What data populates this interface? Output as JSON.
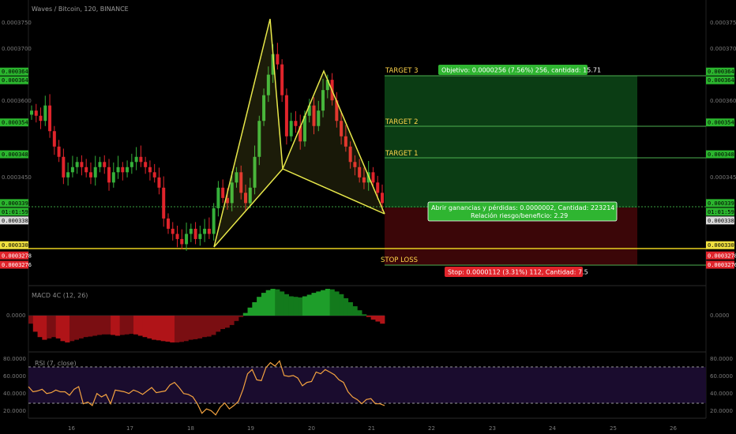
{
  "title": "Waves / Bitcoin, 120, BINANCE",
  "colors": {
    "background": "#000000",
    "candle_up": "#35b03a",
    "candle_down": "#e0242b",
    "pattern": "#e8e84a",
    "target_line": "#4caf50",
    "profit_zone": "#0b3d14",
    "loss_zone": "#3b0608",
    "stop_line": "#e8d020",
    "macd_up": "#1e9e2a",
    "macd_down": "#b01418",
    "rsi_line": "#f4a340",
    "rsi_band": "#1a0c2e"
  },
  "price_axis": {
    "ticks": [
      "0.0003750",
      "0.0003700",
      "0.0003600",
      "0.0003450"
    ],
    "tags_left": [
      {
        "text": "0.0003646",
        "bg": "#2bb52e",
        "fg": "#000000",
        "value": 0.0003646
      },
      {
        "text": "0.0003644",
        "bg": "#2bb52e",
        "fg": "#000000",
        "value": 0.0003644
      },
      {
        "text": "0.0003547",
        "bg": "#2bb52e",
        "fg": "#000000",
        "value": 0.0003547
      },
      {
        "text": "0.0003485",
        "bg": "#2bb52e",
        "fg": "#000000",
        "value": 0.0003485
      },
      {
        "text": "0.0003390",
        "bg": "#2bb52e",
        "fg": "#000000",
        "value": 0.000339
      },
      {
        "text": "01:01:59",
        "bg": "#2bb52e",
        "fg": "#000000",
        "value": 0.0003377
      },
      {
        "text": "0.0003388",
        "bg": "#d9d9d9",
        "fg": "#000000",
        "value": 0.0003363
      },
      {
        "text": "0.0003308",
        "bg": "#f0e040",
        "fg": "#000000",
        "value": 0.0003308
      },
      {
        "text": "0.0003278",
        "bg": "#e0242b",
        "fg": "#ffffff",
        "value": 0.0003288
      },
      {
        "text": "0.0003276",
        "bg": "#e0242b",
        "fg": "#ffffff",
        "value": 0.000327
      }
    ]
  },
  "time_axis": [
    "16",
    "17",
    "18",
    "19",
    "20",
    "21",
    "22",
    "23",
    "24",
    "25",
    "26"
  ],
  "trade": {
    "targets": [
      {
        "label": "TARGET 3",
        "value": 0.0003646
      },
      {
        "label": "TARGET 2",
        "value": 0.0003547
      },
      {
        "label": "TARGET 1",
        "value": 0.0003485
      }
    ],
    "entry": 0.000339,
    "stop_label": "STOP LOSS",
    "stop_value": 0.0003278,
    "support": 0.0003308,
    "objective_text": "Objetivo: 0.0000256 (7.56%) 256, cantidad: 15.71",
    "pnl_line1": "Abrir ganancias y pérdidas: 0.0000002, Cantidad: 223214",
    "pnl_line2": "Relación riesgo/beneficio: 2.29",
    "stop_text": "Stop: 0.0000112 (3.31%) 112, Cantidad: 7.5"
  },
  "macd": {
    "label": "MACD 4C (12, 26)",
    "zero_label": "0.0000"
  },
  "rsi": {
    "label": "RSI (7, close)",
    "ticks": [
      "80.0000",
      "60.0000",
      "40.0000",
      "20.0000"
    ],
    "upper": 70,
    "lower": 30
  },
  "chart_data": [
    {
      "type": "candlestick",
      "title": "Waves / Bitcoin, 120, BINANCE",
      "x_categories": [
        "16",
        "17",
        "18",
        "19",
        "20",
        "21"
      ],
      "close": [
        0.000357,
        0.000356,
        0.000355,
        0.000358,
        0.000353,
        0.00035,
        0.000348,
        0.000344,
        0.000345,
        0.000346,
        0.000347,
        0.000346,
        0.000345,
        0.000344,
        0.000346,
        0.000347,
        0.000346,
        0.000343,
        0.000345,
        0.000346,
        0.000345,
        0.000346,
        0.000347,
        0.000348,
        0.000347,
        0.000346,
        0.000345,
        0.000344,
        0.000342,
        0.000336,
        0.000334,
        0.000333,
        0.000332,
        0.000331,
        0.000333,
        0.000334,
        0.000332,
        0.000333,
        0.000334,
        0.000333,
        0.000338,
        0.000342,
        0.00034,
        0.000339,
        0.000343,
        0.000345,
        0.000341,
        0.000339,
        0.000342,
        0.000348,
        0.000355,
        0.00036,
        0.000364,
        0.000368,
        0.000366,
        0.00036,
        0.000352,
        0.000355,
        0.000354,
        0.000351,
        0.000356,
        0.000358,
        0.000354,
        0.000357,
        0.000361,
        0.000363,
        0.000359,
        0.000355,
        0.000352,
        0.00035,
        0.000347,
        0.000346,
        0.000344,
        0.000343,
        0.000345,
        0.000343,
        0.000341,
        0.000339
      ],
      "y_range": [
        0.000324,
        0.000377
      ],
      "pattern": "harmonic (yellow)",
      "targets": [
        0.0003646,
        0.0003547,
        0.0003485
      ],
      "entry": 0.000339,
      "stop": 0.0003278
    },
    {
      "type": "area",
      "title": "MACD 4C (12, 26)",
      "x": [
        0,
        1,
        2,
        3,
        4,
        5,
        6,
        7,
        8,
        9,
        10,
        11,
        12,
        13,
        14,
        15,
        16,
        17,
        18,
        19,
        20,
        21,
        22,
        23,
        24,
        25,
        26,
        27,
        28,
        29,
        30,
        31,
        32,
        33,
        34,
        35,
        36,
        37,
        38,
        39,
        40,
        41,
        42,
        43,
        44,
        45,
        46,
        47,
        48,
        49,
        50,
        51,
        52,
        53,
        54,
        55,
        56,
        57,
        58,
        59,
        60,
        61,
        62,
        63,
        64,
        65,
        66,
        67,
        68,
        69,
        70,
        71,
        72,
        73,
        74,
        75,
        76,
        77
      ],
      "values": [
        -0.3,
        -0.6,
        -0.8,
        -0.9,
        -0.85,
        -0.8,
        -0.85,
        -0.95,
        -1.0,
        -0.95,
        -0.9,
        -0.85,
        -0.8,
        -0.78,
        -0.75,
        -0.72,
        -0.7,
        -0.7,
        -0.72,
        -0.75,
        -0.72,
        -0.7,
        -0.68,
        -0.7,
        -0.75,
        -0.8,
        -0.85,
        -0.9,
        -0.92,
        -0.95,
        -0.97,
        -1.0,
        -1.0,
        -0.98,
        -0.95,
        -0.9,
        -0.88,
        -0.85,
        -0.8,
        -0.78,
        -0.72,
        -0.6,
        -0.5,
        -0.45,
        -0.35,
        -0.2,
        -0.05,
        0.1,
        0.3,
        0.5,
        0.7,
        0.85,
        0.95,
        1.0,
        0.98,
        0.9,
        0.8,
        0.72,
        0.7,
        0.68,
        0.72,
        0.78,
        0.85,
        0.9,
        0.95,
        1.0,
        0.98,
        0.9,
        0.8,
        0.65,
        0.5,
        0.35,
        0.2,
        0.05,
        -0.05,
        -0.15,
        -0.22,
        -0.3
      ]
    },
    {
      "type": "line",
      "title": "RSI (7, close)",
      "ylim": [
        15,
        85
      ],
      "values": [
        50,
        44,
        45,
        47,
        42,
        43,
        46,
        44,
        44,
        40,
        47,
        50,
        30,
        32,
        28,
        42,
        38,
        41,
        30,
        46,
        45,
        44,
        42,
        46,
        44,
        41,
        45,
        49,
        43,
        44,
        45,
        52,
        55,
        49,
        42,
        41,
        38,
        30,
        19,
        24,
        22,
        17,
        26,
        31,
        24,
        28,
        33,
        47,
        65,
        70,
        58,
        57,
        72,
        78,
        74,
        80,
        63,
        62,
        63,
        60,
        51,
        55,
        56,
        67,
        65,
        70,
        67,
        64,
        58,
        55,
        44,
        38,
        35,
        30,
        35,
        36,
        30,
        30,
        28
      ]
    }
  ]
}
